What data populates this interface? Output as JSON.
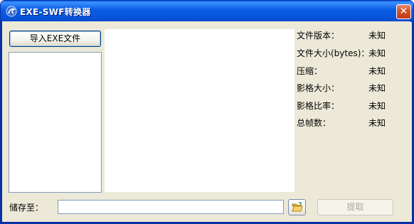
{
  "window": {
    "title": "EXE-SWF转换器",
    "close_symbol": "✕"
  },
  "import_button": "导入EXE文件",
  "info": [
    {
      "label": "文件版本：",
      "value": "未知"
    },
    {
      "label": "文件大小(bytes)：",
      "value": "未知"
    },
    {
      "label": "压缩：",
      "value": "未知"
    },
    {
      "label": "影格大小：",
      "value": "未知"
    },
    {
      "label": "影格比率：",
      "value": "未知"
    },
    {
      "label": "总帧数：",
      "value": "未知"
    }
  ],
  "save": {
    "label": "储存至：",
    "path": "",
    "browse_icon": "folder-open-icon"
  },
  "extract_button": "提取",
  "colors": {
    "titlebar": "#0551d6",
    "window_bg": "#ece9d8",
    "close": "#c13b16",
    "disabled_text": "#aca899"
  }
}
